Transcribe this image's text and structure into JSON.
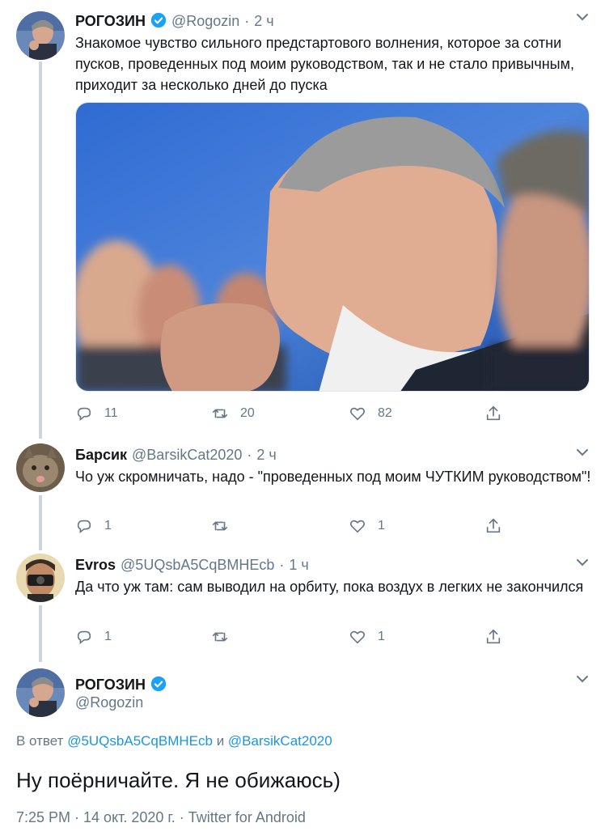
{
  "tweets": [
    {
      "name": "РОГОЗИН",
      "handle": "@Rogozin",
      "time": "2 ч",
      "text": "Знакомое чувство сильного предстартового волнения, которое за сотни пусков, проведенных под моим руководством, так и не стало привычным, приходит за несколько дней до пуска",
      "replies": "11",
      "retweets": "20",
      "likes": "82",
      "verified": true
    },
    {
      "name": "Барсик",
      "handle": "@BarsikCat2020",
      "time": "2 ч",
      "text": "Чо уж скромничать, надо - \"проведенных под моим ЧУТКИМ руководством\"!",
      "replies": "1",
      "retweets": "",
      "likes": "1"
    },
    {
      "name": "Evros",
      "handle": "@5UQsbA5CqBMHEcb",
      "time": "1 ч",
      "text": "Да что уж там: сам выводил на орбиту, пока воздух в легких не закончился",
      "replies": "1",
      "retweets": "",
      "likes": "1"
    }
  ],
  "main": {
    "name": "РОГОЗИН",
    "handle": "@Rogozin",
    "reply_prefix": "В ответ",
    "reply_user1": "@5UQsbA5CqBMHEcb",
    "reply_and": "и",
    "reply_user2": "@BarsikCat2020",
    "text": "Ну поёрничайте. Я не обижаюсь)",
    "meta": "7:25 PM · 14 окт. 2020 г. · Twitter for Android"
  },
  "icons": {
    "reply": "reply-icon",
    "retweet": "retweet-icon",
    "like": "heart-icon",
    "share": "share-icon",
    "caret": "chevron-down-icon",
    "verified": "verified-badge-icon"
  },
  "colors": {
    "accent": "#1b95e0",
    "secondary_text": "#657786",
    "thread_line": "#ccd6dd"
  }
}
